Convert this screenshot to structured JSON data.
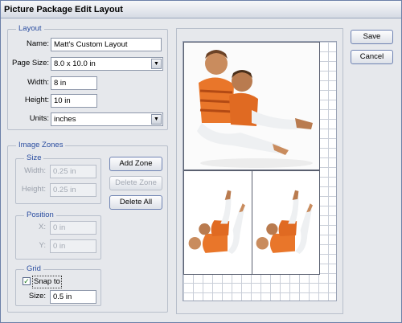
{
  "window": {
    "title": "Picture Package Edit Layout"
  },
  "layout": {
    "group_label": "Layout",
    "name_label": "Name:",
    "name_value": "Matt's Custom Layout",
    "page_size_label": "Page Size:",
    "page_size_value": "8.0 x 10.0 in",
    "width_label": "Width:",
    "width_value": "8 in",
    "height_label": "Height:",
    "height_value": "10 in",
    "units_label": "Units:",
    "units_value": "inches"
  },
  "image_zones": {
    "group_label": "Image Zones",
    "size_label": "Size",
    "width_label": "Width:",
    "width_value": "0.25 in",
    "height_label": "Height:",
    "height_value": "0.25 in",
    "position_label": "Position",
    "x_label": "X:",
    "x_value": "0 in",
    "y_label": "Y:",
    "y_value": "0 in",
    "grid_label": "Grid",
    "snap_label": "Snap to",
    "snap_checked": true,
    "grid_size_label": "Size:",
    "grid_size_value": "0.5 in"
  },
  "buttons": {
    "add_zone": "Add Zone",
    "delete_zone": "Delete Zone",
    "delete_all": "Delete All",
    "save": "Save",
    "cancel": "Cancel"
  },
  "icons": {
    "dropdown": "chevron-down-icon",
    "check": "checkmark-icon"
  }
}
